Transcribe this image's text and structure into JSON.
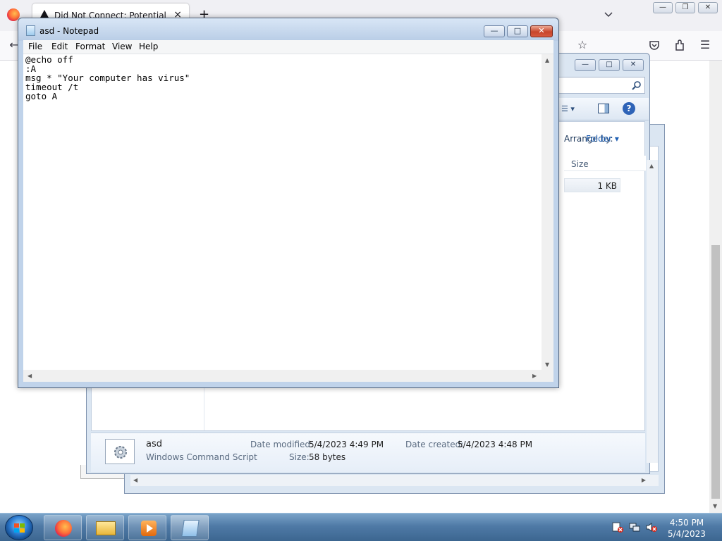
{
  "browser": {
    "tab_title": "Did Not Connect: Potential Security Issue",
    "tab_close": "×",
    "new_tab": "+"
  },
  "explorer": {
    "view_by_label": "Arrange by:",
    "view_by_value": "Folder",
    "column_size": "Size",
    "file_size_value": "1 KB",
    "details": {
      "file_name": "asd",
      "file_type": "Windows Command Script",
      "date_modified_label": "Date modified:",
      "date_modified_value": "5/4/2023 4:49 PM",
      "date_created_label": "Date created:",
      "date_created_value": "5/4/2023 4:48 PM",
      "size_label": "Size:",
      "size_value": "58 bytes"
    }
  },
  "notepad": {
    "title": "asd - Notepad",
    "menu": [
      "File",
      "Edit",
      "Format",
      "View",
      "Help"
    ],
    "content": "@echo off\n:A\nmsg * \"Your computer has virus\"\ntimeout /t\ngoto A"
  },
  "taskbar": {
    "time": "4:50 PM",
    "date": "5/4/2023"
  },
  "colors": {
    "taskbar": "#4f7aa6",
    "notepad_frame": "#c0d3ea",
    "close_button": "#c8452b",
    "firefox_tabbar": "#f0f0f4"
  },
  "icons": [
    "firefox-logo-icon",
    "warning-icon",
    "star-icon",
    "pocket-icon",
    "extensions-icon",
    "menu-icon",
    "search-icon",
    "help-icon",
    "script-file-icon",
    "windows-start-icon",
    "file-explorer-icon",
    "media-player-icon",
    "notepad-icon",
    "network-icon",
    "volume-muted-icon",
    "action-center-icon"
  ]
}
